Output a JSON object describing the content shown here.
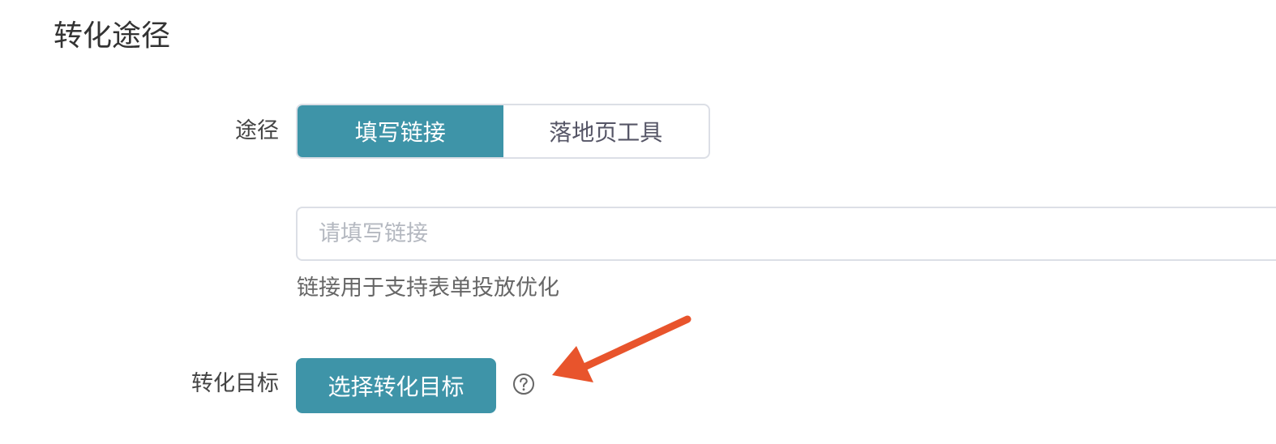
{
  "section": {
    "title": "转化途径"
  },
  "path_row": {
    "label": "途径",
    "options": [
      {
        "label": "填写链接",
        "active": true
      },
      {
        "label": "落地页工具",
        "active": false
      }
    ]
  },
  "link_input": {
    "value": "",
    "placeholder": "请填写链接",
    "help_text": "链接用于支持表单投放优化"
  },
  "goal_row": {
    "label": "转化目标",
    "button_label": "选择转化目标",
    "help_icon": "question-circle-icon"
  },
  "annotation": {
    "icon": "arrow-pointer-icon",
    "color": "#e8542c"
  },
  "colors": {
    "accent": "#3e94a8",
    "border": "#dcdfe6",
    "placeholder": "#b4b8c0"
  }
}
